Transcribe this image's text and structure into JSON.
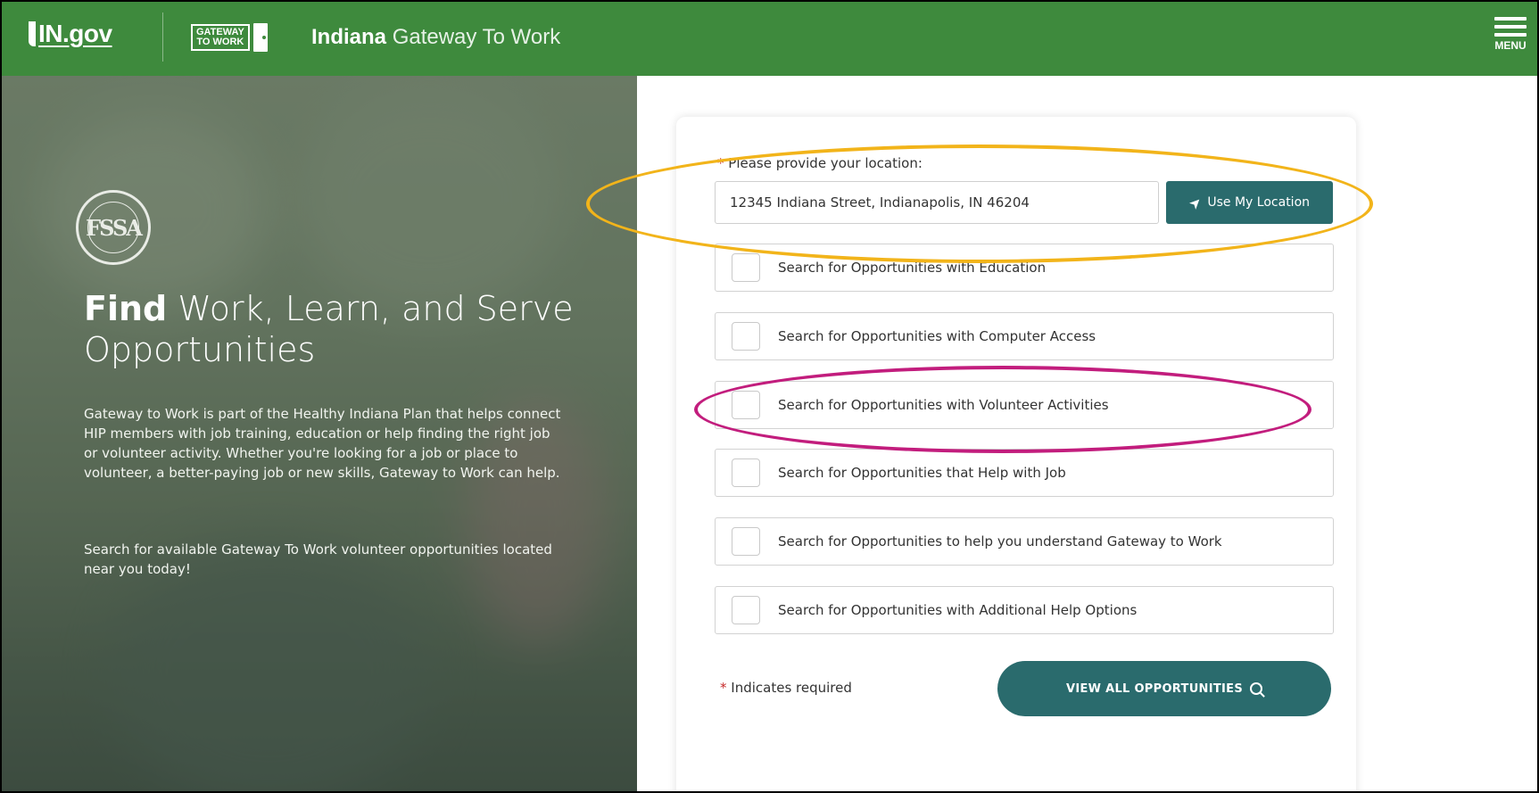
{
  "header": {
    "ingov_logo": "IN.gov",
    "gtw_logo_line1": "GATEWAY",
    "gtw_logo_line2": "TO WORK",
    "title_bold": "Indiana",
    "title_rest": "Gateway To Work",
    "menu_label": "MENU"
  },
  "hero": {
    "seal_text": "FSSA",
    "title_bold": "Find",
    "title_rest": "Work, Learn, and Serve Opportunities",
    "paragraph1": "Gateway to Work is part of the Healthy Indiana Plan that helps connect HIP members with job training, education or help finding the right job or volunteer activity. Whether you're looking for a job or place to volunteer, a better-paying job or new skills, Gateway to Work can help.",
    "paragraph2": "Search for available Gateway To Work volunteer opportunities located near you today!"
  },
  "form": {
    "location_label": "Please provide your location:",
    "required_mark": "*",
    "location_value": "12345 Indiana Street, Indianapolis, IN 46204",
    "use_location_label": "Use My Location",
    "options": [
      {
        "label": "Search for Opportunities with Education",
        "checked": false
      },
      {
        "label": "Search for Opportunities with Computer Access",
        "checked": false
      },
      {
        "label": "Search for Opportunities with Volunteer Activities",
        "checked": false
      },
      {
        "label": "Search for Opportunities that Help with Job",
        "checked": false
      },
      {
        "label": "Search for Opportunities to help you understand Gateway to Work",
        "checked": false
      },
      {
        "label": "Search for Opportunities with Additional Help Options",
        "checked": false
      }
    ],
    "required_note": "Indicates required",
    "view_all_label": "VIEW ALL OPPORTUNITIES"
  },
  "colors": {
    "header_green": "#3e8a3d",
    "button_teal": "#2a6b6d",
    "annotation_yellow": "#f2b41a",
    "annotation_magenta": "#c21d7d"
  }
}
